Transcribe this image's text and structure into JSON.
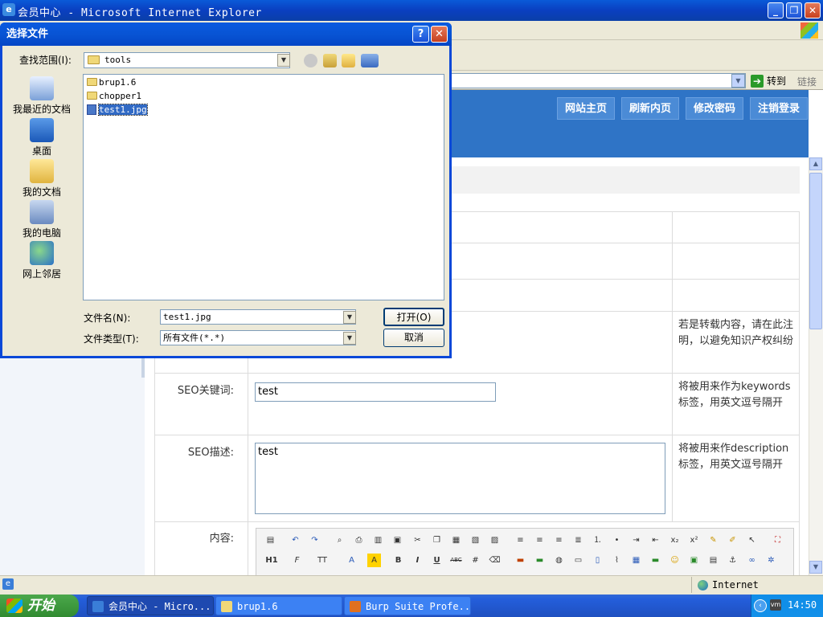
{
  "ie": {
    "title": "会员中心 - Microsoft Internet Explorer",
    "go_label": "转到",
    "links_label": "链接",
    "status_zone": "Internet"
  },
  "site": {
    "nav": [
      "网站主页",
      "刷新内页",
      "修改密码",
      "注销登录"
    ],
    "fields": [
      {
        "label": "",
        "note": "若是转载内容，请在此注明，以避免知识产权纠纷"
      },
      {
        "label": "SEO关键词:",
        "value": "test",
        "note": "将被用来作为keywords标签，用英文逗号隔开"
      },
      {
        "label": "SEO描述:",
        "value": "test",
        "note": "将被用来作description标签，用英文逗号隔开"
      },
      {
        "label": "内容:"
      }
    ],
    "editor_row2": [
      "H1",
      "F",
      "TT",
      "A",
      "A",
      "B",
      "I",
      "U",
      "ABC"
    ]
  },
  "dialog": {
    "title": "选择文件",
    "lookin_label": "查找范围(I):",
    "lookin_value": "tools",
    "places": [
      "我最近的文档",
      "桌面",
      "我的文档",
      "我的电脑",
      "网上邻居"
    ],
    "files": [
      {
        "name": "brup1.6",
        "type": "folder",
        "selected": false
      },
      {
        "name": "chopper1",
        "type": "folder",
        "selected": false
      },
      {
        "name": "test1.jpg",
        "type": "image",
        "selected": true
      }
    ],
    "filename_label": "文件名(N):",
    "filename_value": "test1.jpg",
    "filetype_label": "文件类型(T):",
    "filetype_value": "所有文件(*.*)",
    "open_button": "打开(O)",
    "cancel_button": "取消"
  },
  "taskbar": {
    "start": "开始",
    "tasks": [
      {
        "label": "会员中心 - Micro...",
        "active": true
      },
      {
        "label": "brup1.6",
        "active": false
      },
      {
        "label": "Burp Suite Profe...",
        "active": false
      }
    ],
    "clock": "14:50"
  },
  "colors": {
    "header": "#2f74c6",
    "selection": "#316ac5",
    "xp_title": "#0a48d8",
    "taskbar": "#245edb"
  }
}
